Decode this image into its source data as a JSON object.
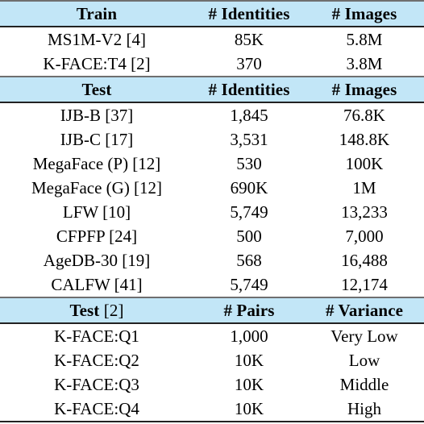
{
  "table": {
    "colors": {
      "header_band": "#c2e6f7",
      "rule_dark": "#222222",
      "rule_gray": "#6f6f6f",
      "background": "#ffffff",
      "text": "#000000"
    },
    "sections": [
      {
        "header": {
          "col1": "Train",
          "col1_suffix": "",
          "col2": "# Identities",
          "col3": "# Images"
        },
        "rows": [
          {
            "name": "MS1M-V2 [4]",
            "col2": "85K",
            "col3": "5.8M"
          },
          {
            "name": "K-FACE:T4 [2]",
            "col2": "370",
            "col3": "3.8M"
          }
        ]
      },
      {
        "header": {
          "col1": "Test",
          "col1_suffix": "",
          "col2": "# Identities",
          "col3": "# Images"
        },
        "rows": [
          {
            "name": "IJB-B [37]",
            "col2": "1,845",
            "col3": "76.8K"
          },
          {
            "name": "IJB-C [17]",
            "col2": "3,531",
            "col3": "148.8K"
          },
          {
            "name": "MegaFace (P) [12]",
            "col2": "530",
            "col3": "100K"
          },
          {
            "name": "MegaFace (G) [12]",
            "col2": "690K",
            "col3": "1M"
          },
          {
            "name": "LFW [10]",
            "col2": "5,749",
            "col3": "13,233"
          },
          {
            "name": "CFPFP [24]",
            "col2": "500",
            "col3": "7,000"
          },
          {
            "name": "AgeDB-30 [19]",
            "col2": "568",
            "col3": "16,488"
          },
          {
            "name": "CALFW [41]",
            "col2": "5,749",
            "col3": "12,174"
          }
        ]
      },
      {
        "header": {
          "col1": "Test",
          "col1_suffix": " [2]",
          "col2": "# Pairs",
          "col3": "# Variance"
        },
        "rows": [
          {
            "name": "K-FACE:Q1",
            "col2": "1,000",
            "col3": "Very Low"
          },
          {
            "name": "K-FACE:Q2",
            "col2": "10K",
            "col3": "Low"
          },
          {
            "name": "K-FACE:Q3",
            "col2": "10K",
            "col3": "Middle"
          },
          {
            "name": "K-FACE:Q4",
            "col2": "10K",
            "col3": "High"
          }
        ]
      }
    ]
  }
}
